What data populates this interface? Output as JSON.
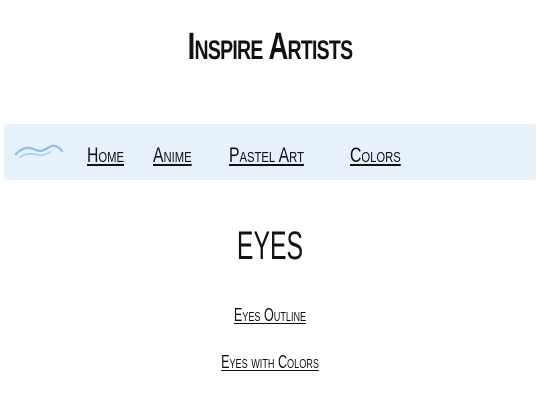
{
  "header": {
    "site_title": "Inspire Artists"
  },
  "nav": {
    "logo_icon": "brush-stroke-icon",
    "items": [
      {
        "label": "Home"
      },
      {
        "label": "Anime"
      },
      {
        "label": "Pastel Art"
      },
      {
        "label": "Colors"
      }
    ]
  },
  "main": {
    "heading": "EYES",
    "links": [
      {
        "label": "Eyes Outline"
      },
      {
        "label": "Eyes with Colors"
      }
    ]
  },
  "colors": {
    "navbar_bg": "#e6f1fc",
    "logo_stroke": "#8fc3e6",
    "text": "#111111"
  }
}
